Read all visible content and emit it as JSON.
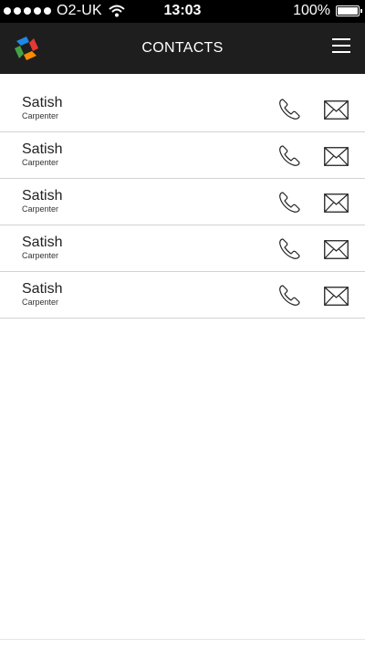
{
  "status_bar": {
    "carrier": "O2-UK",
    "time": "13:03",
    "battery": "100%",
    "icons": [
      "signal-dots-icon",
      "wifi-icon",
      "battery-icon"
    ]
  },
  "header": {
    "title": "CONTACTS",
    "logo_icon": "app-logo-icon",
    "menu_icon": "hamburger-menu-icon"
  },
  "contacts": [
    {
      "name": "Satish",
      "role": "Carpenter"
    },
    {
      "name": "Satish",
      "role": "Carpenter"
    },
    {
      "name": "Satish",
      "role": "Carpenter"
    },
    {
      "name": "Satish",
      "role": "Carpenter"
    },
    {
      "name": "Satish",
      "role": "Carpenter"
    }
  ],
  "colors": {
    "status_bar_bg": "#000000",
    "header_bg": "#1e1e1e",
    "list_bg": "#ffffff",
    "divider": "#d2d2d2",
    "logo_red": "#e53935",
    "logo_blue": "#1e88e5",
    "logo_green": "#43a047",
    "logo_orange": "#fb8c00"
  }
}
